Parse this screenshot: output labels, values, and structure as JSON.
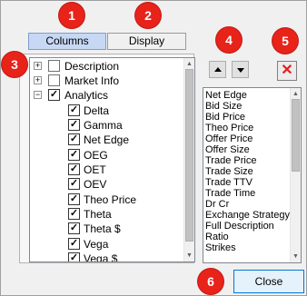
{
  "tabs": [
    {
      "label": "Columns",
      "active": true
    },
    {
      "label": "Display",
      "active": false
    }
  ],
  "tree": {
    "items": [
      {
        "label": "Description",
        "checked": false,
        "expandable": true,
        "expanded": false,
        "level": 0
      },
      {
        "label": "Market Info",
        "checked": false,
        "expandable": true,
        "expanded": false,
        "level": 0
      },
      {
        "label": "Analytics",
        "checked": true,
        "expandable": true,
        "expanded": true,
        "level": 0
      },
      {
        "label": "Delta",
        "checked": true,
        "level": 1
      },
      {
        "label": "Gamma",
        "checked": true,
        "level": 1
      },
      {
        "label": "Net Edge",
        "checked": true,
        "level": 1
      },
      {
        "label": "OEG",
        "checked": true,
        "level": 1
      },
      {
        "label": "OET",
        "checked": true,
        "level": 1
      },
      {
        "label": "OEV",
        "checked": true,
        "level": 1
      },
      {
        "label": "Theo Price",
        "checked": true,
        "level": 1
      },
      {
        "label": "Theta",
        "checked": true,
        "level": 1
      },
      {
        "label": "Theta $",
        "checked": true,
        "level": 1
      },
      {
        "label": "Vega",
        "checked": true,
        "level": 1
      },
      {
        "label": "Vega $",
        "checked": true,
        "level": 1
      }
    ]
  },
  "selected_fields": [
    "Net Edge",
    "Bid Size",
    "Bid Price",
    "Theo Price",
    "Offer Price",
    "Offer Size",
    "Trade Price",
    "Trade Size",
    "Trade TTV",
    "Trade Time",
    "Dr Cr",
    "Exchange Strategy",
    "Full Description",
    "Ratio",
    "Strikes"
  ],
  "buttons": {
    "move_up_icon": "triangle-up",
    "move_down_icon": "triangle-down",
    "remove_glyph": "✕",
    "close_label": "Close"
  },
  "callouts": [
    "1",
    "2",
    "3",
    "4",
    "5",
    "6"
  ],
  "colors": {
    "callout_red": "#e8231a",
    "active_tab": "#c7d8f4",
    "remove_red": "#e02020",
    "close_border": "#0078d7"
  },
  "glyphs": {
    "check": "✓",
    "expand": "+",
    "collapse": "−"
  }
}
